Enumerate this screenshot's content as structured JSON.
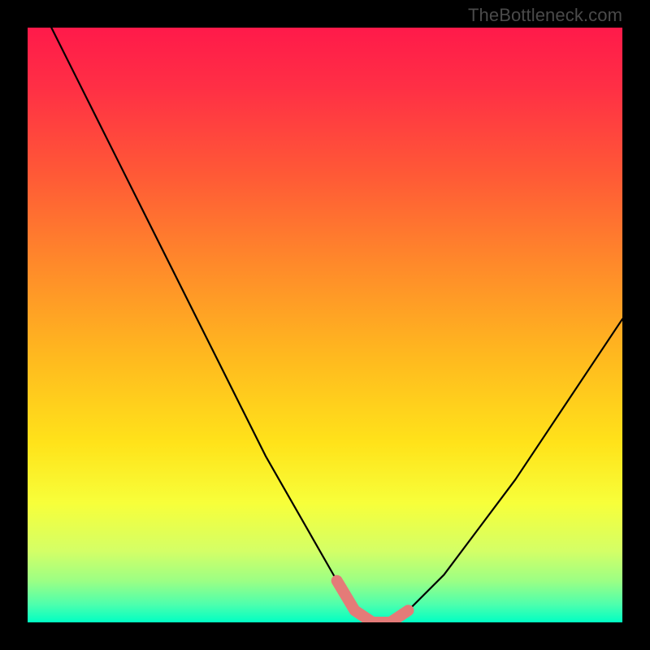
{
  "watermark": "TheBottleneck.com",
  "colors": {
    "frame": "#000000",
    "curve": "#000000",
    "overlay_pink": "#e47b78",
    "gradient_stops": [
      {
        "offset": 0.0,
        "color": "#ff1a4a"
      },
      {
        "offset": 0.1,
        "color": "#ff2f45"
      },
      {
        "offset": 0.25,
        "color": "#ff5a36"
      },
      {
        "offset": 0.4,
        "color": "#ff8a2a"
      },
      {
        "offset": 0.55,
        "color": "#ffb81f"
      },
      {
        "offset": 0.7,
        "color": "#ffe31a"
      },
      {
        "offset": 0.8,
        "color": "#f7ff3a"
      },
      {
        "offset": 0.88,
        "color": "#d4ff66"
      },
      {
        "offset": 0.93,
        "color": "#9cff84"
      },
      {
        "offset": 0.97,
        "color": "#4dffad"
      },
      {
        "offset": 1.0,
        "color": "#00ffc3"
      }
    ]
  },
  "chart_data": {
    "type": "line",
    "title": "",
    "xlabel": "",
    "ylabel": "",
    "xlim": [
      0,
      100
    ],
    "ylim": [
      0,
      100
    ],
    "grid": false,
    "legend": false,
    "series": [
      {
        "name": "bottleneck-curve",
        "x": [
          4,
          8,
          12,
          16,
          20,
          24,
          28,
          32,
          36,
          40,
          44,
          48,
          52,
          55,
          58,
          61,
          64,
          70,
          76,
          82,
          88,
          94,
          100
        ],
        "y": [
          100,
          92,
          84,
          76,
          68,
          60,
          52,
          44,
          36,
          28,
          21,
          14,
          7,
          2,
          0,
          0,
          2,
          8,
          16,
          24,
          33,
          42,
          51
        ]
      }
    ],
    "overlay": {
      "name": "flat-valley-highlight",
      "color": "#e47b78",
      "x": [
        52,
        55,
        58,
        61,
        64
      ],
      "y": [
        7,
        2,
        0,
        0,
        2
      ]
    }
  }
}
